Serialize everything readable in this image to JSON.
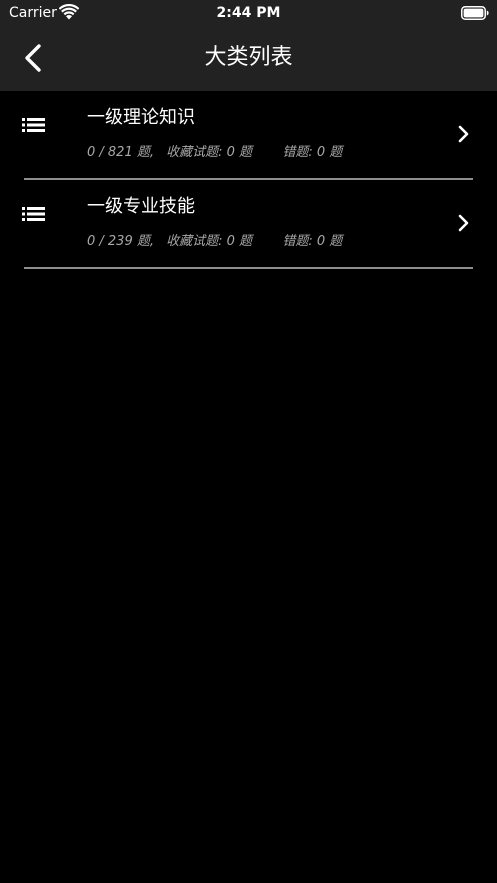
{
  "status_bar": {
    "carrier": "Carrier",
    "time": "2:44 PM"
  },
  "nav": {
    "title": "大类列表",
    "back_icon": "chevron-left-icon"
  },
  "list": [
    {
      "title": "一级理论知识",
      "progress": "0 / 821 题,",
      "favorites": "收藏试题: 0 题",
      "mistakes": "错题: 0 题",
      "icon": "list-icon"
    },
    {
      "title": "一级专业技能",
      "progress": "0 / 239 题,",
      "favorites": "收藏试题: 0 题",
      "mistakes": "错题: 0 题",
      "icon": "list-icon"
    }
  ],
  "colors": {
    "background": "#000000",
    "header": "#222222",
    "text": "#ffffff",
    "subtext": "#a8a8a8",
    "divider": "#8e8e8e"
  }
}
